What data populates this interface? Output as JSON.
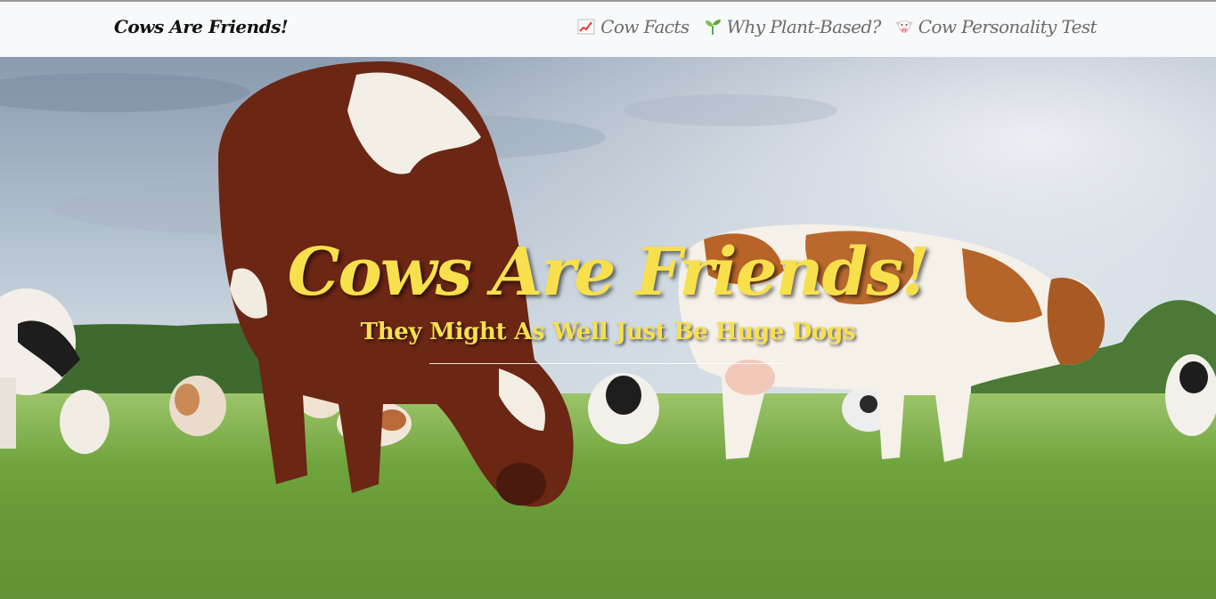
{
  "navbar": {
    "brand": "Cows Are Friends!",
    "links": [
      {
        "label": "Cow Facts",
        "icon": "chart-increasing-icon"
      },
      {
        "label": "Why Plant-Based?",
        "icon": "seedling-icon"
      },
      {
        "label": "Cow Personality Test",
        "icon": "cow-face-icon"
      }
    ]
  },
  "hero": {
    "title": "Cows Are Friends!",
    "subtitle": "They Might As Well Just Be Huge Dogs",
    "image": "cows-grazing-in-pasture",
    "colors": {
      "title": "#f8e04c",
      "navbar_bg": "#f8f9fa",
      "nav_link": "#6b6b6b"
    }
  }
}
